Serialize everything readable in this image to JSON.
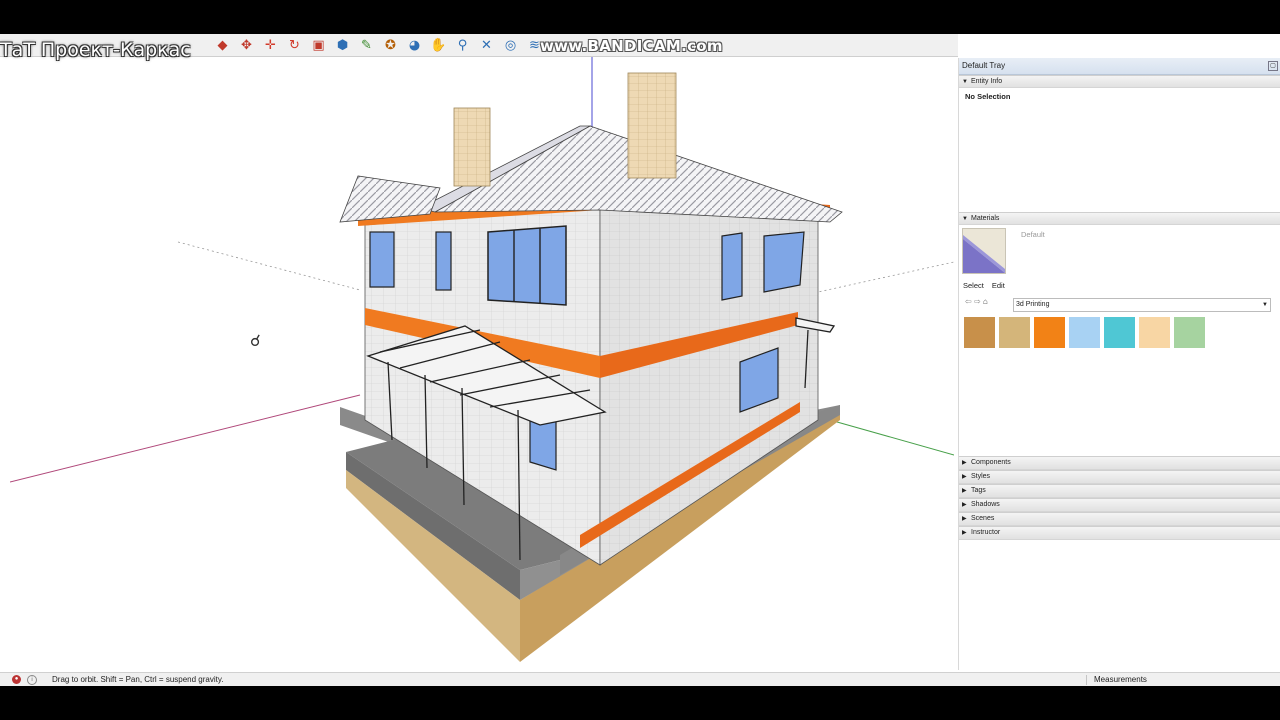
{
  "overlay_title": "ТаТ Проект-Каркас",
  "watermark": "www.BANDICAM.com",
  "toolbar": {
    "icons": [
      {
        "name": "paint-bucket-icon",
        "glyph": "◆",
        "color": "#c0392b"
      },
      {
        "name": "orbit-icon",
        "glyph": "✥",
        "color": "#c0392b"
      },
      {
        "name": "move-icon",
        "glyph": "✛",
        "color": "#d23a2a"
      },
      {
        "name": "rotate-icon",
        "glyph": "↻",
        "color": "#d23a2a"
      },
      {
        "name": "scale-icon",
        "glyph": "▣",
        "color": "#c0392b"
      },
      {
        "name": "section-plane-icon",
        "glyph": "⬢",
        "color": "#2e6fb5"
      },
      {
        "name": "tape-measure-icon",
        "glyph": "✎",
        "color": "#3a8a2c"
      },
      {
        "name": "protractor-icon",
        "glyph": "✪",
        "color": "#b45f06"
      },
      {
        "name": "orbit-active-icon",
        "glyph": "◕",
        "color": "#2e6fb5"
      },
      {
        "name": "pan-icon",
        "glyph": "✋",
        "color": "#c89b2a"
      },
      {
        "name": "zoom-icon",
        "glyph": "⚲",
        "color": "#2e6fb5"
      },
      {
        "name": "zoom-extents-icon",
        "glyph": "✕",
        "color": "#2e6fb5"
      },
      {
        "name": "geo-location-icon",
        "glyph": "◎",
        "color": "#2e6fb5"
      },
      {
        "name": "warehouse-icon",
        "glyph": "≋",
        "color": "#2e6fb5"
      }
    ]
  },
  "tray": {
    "title": "Default Tray",
    "entity_info": {
      "header": "Entity Info",
      "selection": "No Selection"
    },
    "materials": {
      "header": "Materials",
      "current_name": "Default",
      "tabs": [
        "Select",
        "Edit"
      ],
      "library": "3d Printing",
      "swatches": [
        "#c8904a",
        "#d4b57a",
        "#f28216",
        "#a8d2f3",
        "#4fc7d4",
        "#f8d6a4",
        "#a6d3a0"
      ]
    },
    "collapsed_panels": [
      "Components",
      "Styles",
      "Tags",
      "Shadows",
      "Scenes",
      "Instructor"
    ]
  },
  "status": {
    "text": "Drag to orbit. Shift = Pan, Ctrl = suspend gravity.",
    "measurements_label": "Measurements"
  }
}
